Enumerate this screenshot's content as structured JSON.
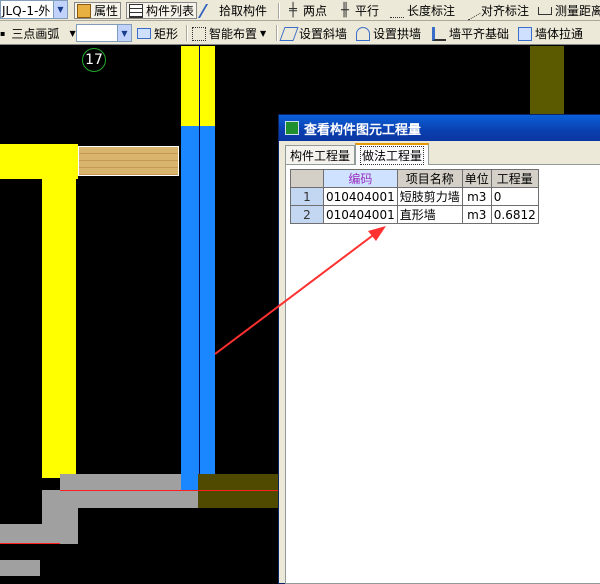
{
  "toolbar1": {
    "combo_value": "JLQ-1-外",
    "attributes_label": "属性",
    "component_list_label": "构件列表",
    "pick_component_label": "拾取构件",
    "two_points_label": "两点",
    "parallel_label": "平行",
    "length_dim_label": "长度标注",
    "align_dim_label": "对齐标注",
    "measure_dist_label": "测量距离"
  },
  "toolbar2": {
    "arc_label": "三点画弧",
    "combo_value": "",
    "rect_label": "矩形",
    "smart_layout_label": "智能布置",
    "slope_wall_label": "设置斜墙",
    "arch_wall_label": "设置拱墙",
    "wall_align_base_label": "墙平齐基础",
    "wall_stretch_label": "墙体拉通"
  },
  "canvas": {
    "axis_number": "17"
  },
  "dialog": {
    "title": "查看构件图元工程量",
    "tabs": [
      {
        "label": "构件工程量",
        "active": false
      },
      {
        "label": "做法工程量",
        "active": true
      }
    ],
    "table": {
      "headers": [
        "编码",
        "项目名称",
        "单位",
        "工程量"
      ],
      "rows": [
        {
          "index": "1",
          "code": "010404001",
          "name": "短肢剪力墙",
          "unit": "m3",
          "qty": "0"
        },
        {
          "index": "2",
          "code": "010404001",
          "name": "直形墙",
          "unit": "m3",
          "qty": "0.6812"
        }
      ]
    }
  },
  "colors": {
    "wall_yellow": "#ffff00",
    "wall_blue": "#1a86ff",
    "slab_gray": "#a0a0a0",
    "arrow_red": "#ff3030",
    "title_blue": "#0a4ed0"
  }
}
